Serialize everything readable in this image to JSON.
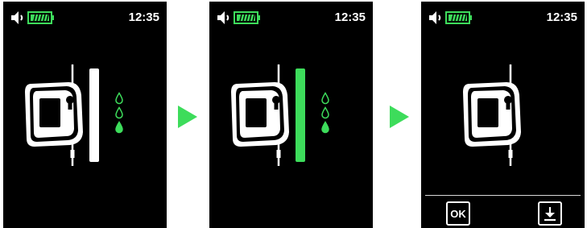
{
  "colors": {
    "screen_bg": "#000000",
    "accent_green": "#3ddc5b",
    "foreground": "#ffffff"
  },
  "screens": [
    {
      "time": "12:35",
      "battery_icon": "battery-full-icon",
      "speaker_icon": "speaker-icon",
      "device_icon": "meter-device-icon",
      "progress_bar_state": "idle",
      "progress_bar_color": "#ffffff",
      "drops": [
        "outline",
        "outline",
        "filled"
      ]
    },
    {
      "time": "12:35",
      "battery_icon": "battery-full-icon",
      "speaker_icon": "speaker-icon",
      "device_icon": "meter-device-icon",
      "progress_bar_state": "active",
      "progress_bar_color": "#3ddc5b",
      "drops": [
        "outline",
        "outline",
        "filled"
      ]
    },
    {
      "time": "12:35",
      "battery_icon": "battery-full-icon",
      "speaker_icon": "speaker-icon",
      "device_icon": "meter-device-icon",
      "softkeys": {
        "ok_label": "OK",
        "download_icon": "download-icon"
      }
    }
  ],
  "transition_icon": "play-arrow-icon"
}
